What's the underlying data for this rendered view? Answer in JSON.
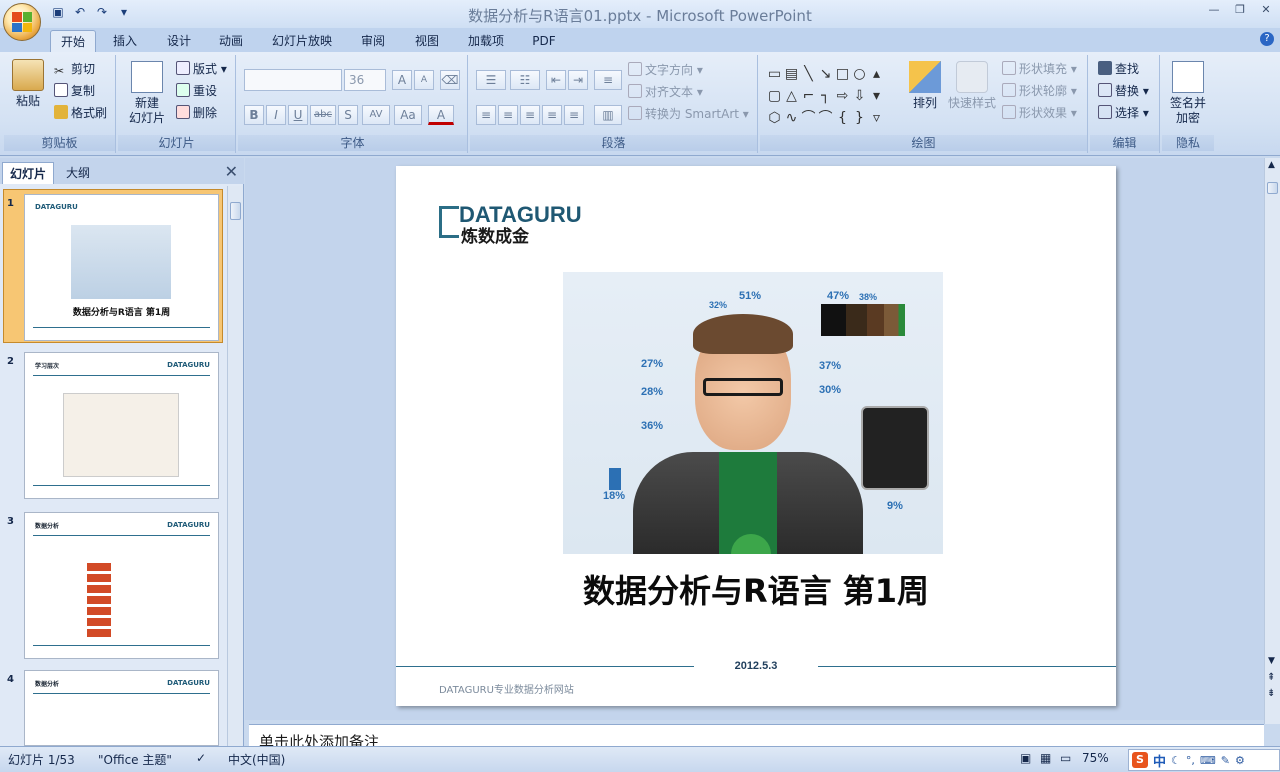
{
  "window": {
    "title": "数据分析与R语言01.pptx - Microsoft PowerPoint"
  },
  "tabs": [
    "开始",
    "插入",
    "设计",
    "动画",
    "幻灯片放映",
    "审阅",
    "视图",
    "加载项",
    "PDF"
  ],
  "ribbon": {
    "clipboard": {
      "label": "剪贴板",
      "paste": "粘贴",
      "cut": "剪切",
      "copy": "复制",
      "format_painter": "格式刷"
    },
    "slides": {
      "label": "幻灯片",
      "new_slide_1": "新建",
      "new_slide_2": "幻灯片",
      "layout": "版式",
      "reset": "重设",
      "delete": "删除"
    },
    "font": {
      "label": "字体",
      "font_name": "",
      "font_size": "36",
      "grow": "A",
      "shrink": "A",
      "bold": "B",
      "italic": "I",
      "underline": "U",
      "strike": "abc",
      "shadow": "S",
      "spacing": "AV",
      "case": "Aa",
      "color": "A"
    },
    "paragraph": {
      "label": "段落",
      "text_direction": "文字方向",
      "align_text": "对齐文本",
      "smartart": "转换为 SmartArt"
    },
    "drawing": {
      "label": "绘图",
      "arrange": "排列",
      "quick_styles": "快速样式",
      "shape_fill": "形状填充",
      "shape_outline": "形状轮廓",
      "shape_effects": "形状效果"
    },
    "editing": {
      "label": "编辑",
      "find": "查找",
      "replace": "替换",
      "select": "选择"
    },
    "privacy": {
      "label": "隐私",
      "sign_1": "签名并",
      "sign_2": "加密"
    }
  },
  "left_pane": {
    "tab_slides": "幻灯片",
    "tab_outline": "大纲",
    "thumbnails": [
      {
        "num": "1",
        "title": "数据分析与R语言 第1周"
      },
      {
        "num": "2",
        "title": "学习层次"
      },
      {
        "num": "3",
        "title": "数据分析"
      },
      {
        "num": "4",
        "title": "数据分析"
      }
    ],
    "thumb_logo": "DATAGURU"
  },
  "slide": {
    "logo_en": "DATAGURU",
    "logo_cn": "炼数成金",
    "title": "数据分析与R语言 第1周",
    "date": "2012.5.3",
    "footer": "DATAGURU专业数据分析网站",
    "stats": [
      "51%",
      "32%",
      "47%",
      "38%",
      "27%",
      "28%",
      "37%",
      "30%",
      "36%",
      "18%",
      "9%"
    ]
  },
  "notes": {
    "placeholder": "单击此处添加备注"
  },
  "status": {
    "slide_count": "幻灯片 1/53",
    "theme": "\"Office 主题\"",
    "language": "中文(中国)",
    "zoom": "75%"
  },
  "ime": {
    "mode": "中"
  },
  "colors": {
    "accent": "#2e6f8e",
    "ribbon_bg": "#d3e1f3",
    "workspace": "#c3d4ec",
    "thumb_selected": "#f7c673"
  }
}
